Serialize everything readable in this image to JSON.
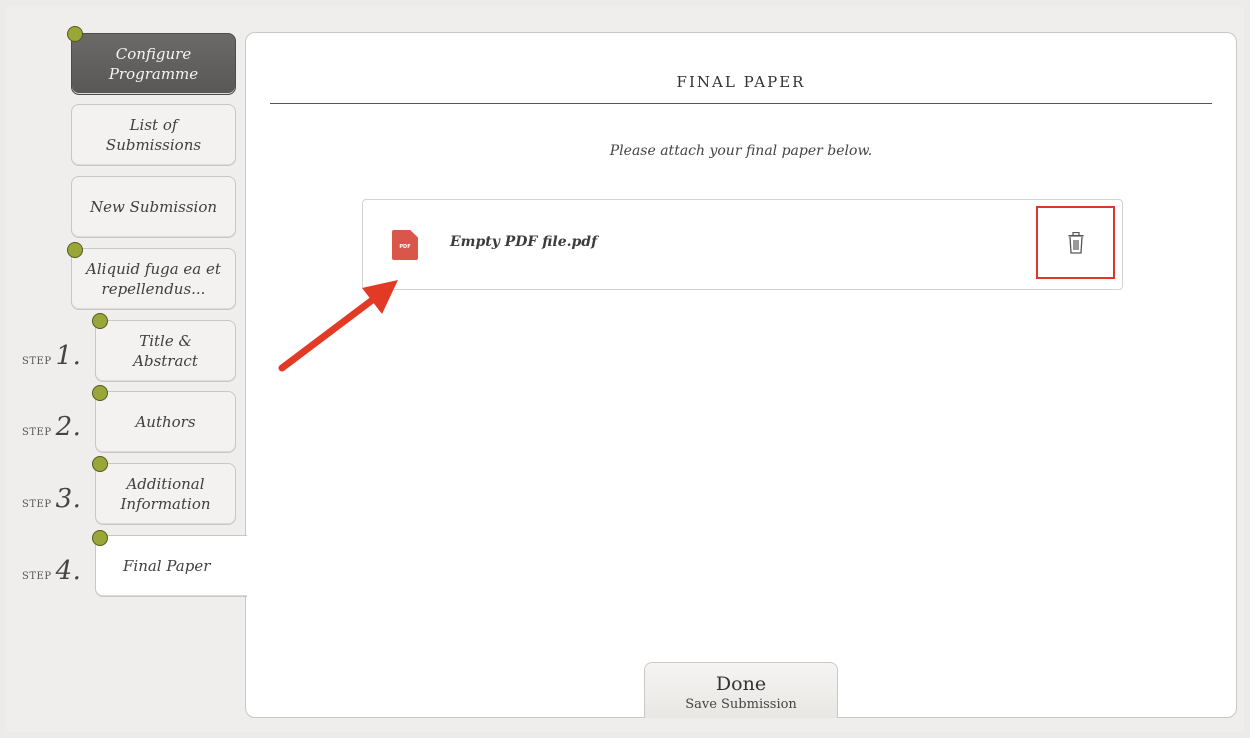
{
  "sidebar": {
    "configure": "Configure Programme",
    "list": "List of Submissions",
    "new": "New Submission",
    "submission": "Aliquid fuga ea et repellendus...",
    "step_word": "STEP",
    "steps": [
      {
        "num": "1.",
        "label": "Title & Abstract"
      },
      {
        "num": "2.",
        "label": "Authors"
      },
      {
        "num": "3.",
        "label": "Additional Information"
      },
      {
        "num": "4.",
        "label": "Final Paper"
      }
    ]
  },
  "main": {
    "title": "FINAL PAPER",
    "instruction": "Please attach your final paper below.",
    "file": {
      "name": "Empty PDF file.pdf",
      "icon_text": "PDF",
      "icon": "pdf-file-icon"
    },
    "delete_icon": "trash-icon"
  },
  "footer": {
    "done_label": "Done",
    "done_sub": "Save Submission"
  },
  "colors": {
    "accent_dot": "#9aa637",
    "highlight": "#e2352a",
    "pdf_icon": "#d9574a"
  }
}
